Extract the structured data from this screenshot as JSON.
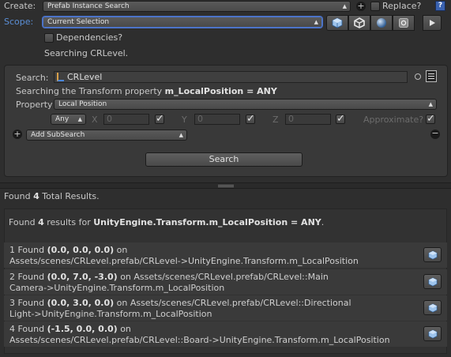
{
  "create": {
    "label": "Create:",
    "value": "Prefab Instance Search",
    "replace_label": "Replace?"
  },
  "scope": {
    "label": "Scope:",
    "value": "Current Selection",
    "dependencies_label": "Dependencies?",
    "searching_text": "Searching CRLevel."
  },
  "search": {
    "label": "Search:",
    "value": "CRLevel",
    "description_prefix": "Searching the Transform property",
    "description_property": "m_LocalPosition = ANY",
    "property_label": "Property",
    "property_value": "Local Position",
    "mode_value": "Any",
    "x_label": "X",
    "x_value": "0",
    "y_label": "Y",
    "y_value": "0",
    "z_label": "Z",
    "z_value": "0",
    "approximate_label": "Approximate?",
    "add_subsearch_label": "Add SubSearch",
    "search_button": "Search"
  },
  "results": {
    "total_prefix": "Found",
    "total_count": "4",
    "total_suffix": "Total Results.",
    "header_prefix": "Found",
    "header_count": "4",
    "header_mid": "results for",
    "header_target": "UnityEngine.Transform.m_LocalPosition = ANY",
    "header_suffix": ".",
    "items": [
      {
        "index": "1",
        "found": "Found",
        "value": "(0.0, 0.0, 0.0)",
        "line1_rest": "on",
        "line2": "Assets/scenes/CRLevel.prefab/CRLevel->UnityEngine.Transform.m_LocalPosition"
      },
      {
        "index": "2",
        "found": "Found",
        "value": "(0.0, 7.0, -3.0)",
        "line1_rest": "on Assets/scenes/CRLevel.prefab/CRLevel::Main",
        "line2": "Camera->UnityEngine.Transform.m_LocalPosition"
      },
      {
        "index": "3",
        "found": "Found",
        "value": "(0.0, 3.0, 0.0)",
        "line1_rest": "on Assets/scenes/CRLevel.prefab/CRLevel::Directional",
        "line2": "Light->UnityEngine.Transform.m_LocalPosition"
      },
      {
        "index": "4",
        "found": "Found",
        "value": "(-1.5, 0.0, 0.0)",
        "line1_rest": "on",
        "line2": "Assets/scenes/CRLevel.prefab/CRLevel::Board->UnityEngine.Transform.m_LocalPosition"
      }
    ]
  },
  "icons": {
    "scope_toolbar": [
      "prefab-cube-icon",
      "unity-logo-icon",
      "sphere-icon",
      "settings-asset-icon",
      "play-icon"
    ],
    "help": "help-book-icon",
    "add_create": "add-circle-icon",
    "search_clear": "clear-circle-icon",
    "search_menu": "hamburger-menu-icon",
    "add_subsearch": "add-circle-icon",
    "remove_subsearch": "remove-circle-icon",
    "result_ping": "prefab-cube-icon"
  },
  "colors": {
    "background": "#2e2e2e",
    "scope_label": "#5b8fd6",
    "scope_focus": "#4c74c9",
    "panel": "#393939"
  }
}
